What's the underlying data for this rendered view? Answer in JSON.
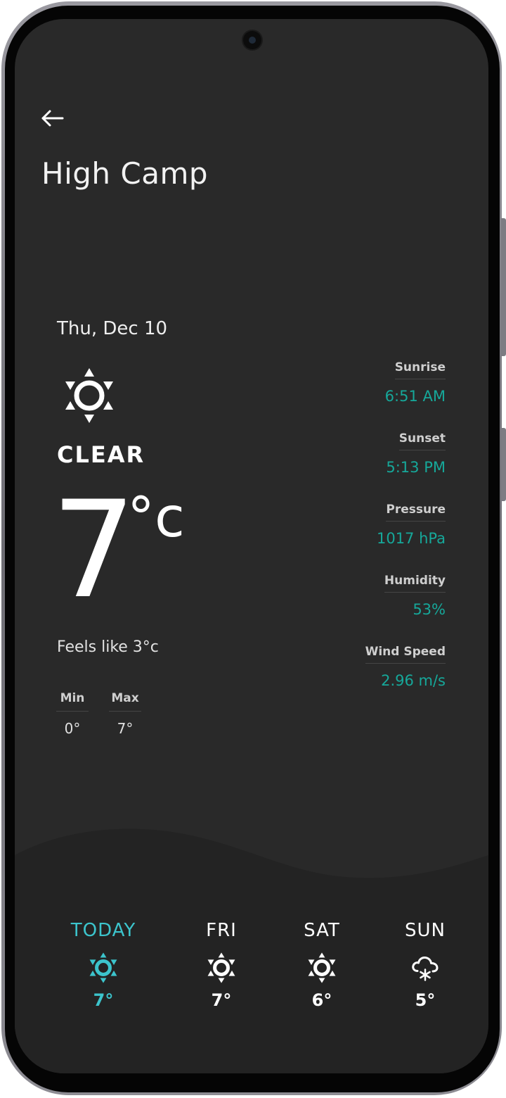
{
  "location": {
    "title": "High Camp"
  },
  "current": {
    "date": "Thu, Dec 10",
    "condition": "CLEAR",
    "condition_icon": "sun-icon",
    "temperature": "7",
    "unit": "°c",
    "feels_like": "Feels like 3°c",
    "min_label": "Min",
    "min_value": "0°",
    "max_label": "Max",
    "max_value": "7°"
  },
  "stats": [
    {
      "label": "Sunrise",
      "value": "6:51 AM"
    },
    {
      "label": "Sunset",
      "value": "5:13 PM"
    },
    {
      "label": "Pressure",
      "value": "1017 hPa"
    },
    {
      "label": "Humidity",
      "value": "53%"
    },
    {
      "label": "Wind Speed",
      "value": "2.96 m/s"
    }
  ],
  "forecast": [
    {
      "day": "TODAY",
      "temp": "7°",
      "icon": "sun-icon",
      "active": true
    },
    {
      "day": "FRI",
      "temp": "7°",
      "icon": "sun-icon",
      "active": false
    },
    {
      "day": "SAT",
      "temp": "6°",
      "icon": "sun-icon",
      "active": false
    },
    {
      "day": "SUN",
      "temp": "5°",
      "icon": "snow-cloud-icon",
      "active": false
    }
  ],
  "colors": {
    "background": "#292929",
    "accent_teal": "#16a89a",
    "today_cyan": "#3cc4cc",
    "text": "#ffffff"
  }
}
